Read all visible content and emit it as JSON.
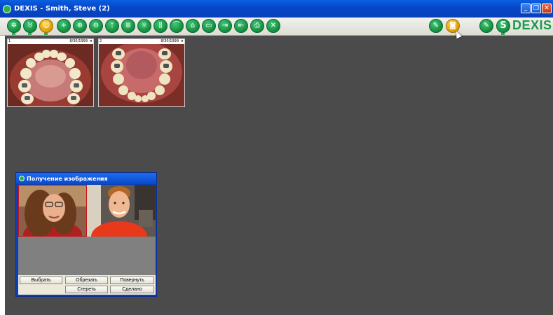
{
  "window": {
    "title": "DEXIS - Smith, Steve (2)"
  },
  "toolbar": {
    "left_icons": [
      "dexis-logo-icon",
      "tooth-icon",
      "person-icon",
      "plus-icon",
      "zoom-in-icon",
      "zoom-out-icon",
      "tooth-select-icon",
      "notes-icon",
      "brightness-icon",
      "teeth-compare-icon",
      "tooth-chart-icon",
      "home-icon",
      "open-folder-icon",
      "import-icon",
      "export-icon",
      "print-icon",
      "close-x-icon"
    ],
    "right_icons": [
      "pen-icon",
      "camera-icon",
      "edit-icon"
    ],
    "logo_text": "DEXIS",
    "logo_letter": "S"
  },
  "thumbnails": [
    {
      "index": "1",
      "date": "8/30/1999",
      "close": "×"
    },
    {
      "index": "2",
      "date": "8/30/1999",
      "close": "×"
    }
  ],
  "dialog": {
    "title": "Получение изображения",
    "buttons": {
      "select": "Выбрать",
      "crop": "Обрезать",
      "rotate": "Повернуть",
      "erase": "Стереть",
      "done": "Сделано"
    }
  }
}
